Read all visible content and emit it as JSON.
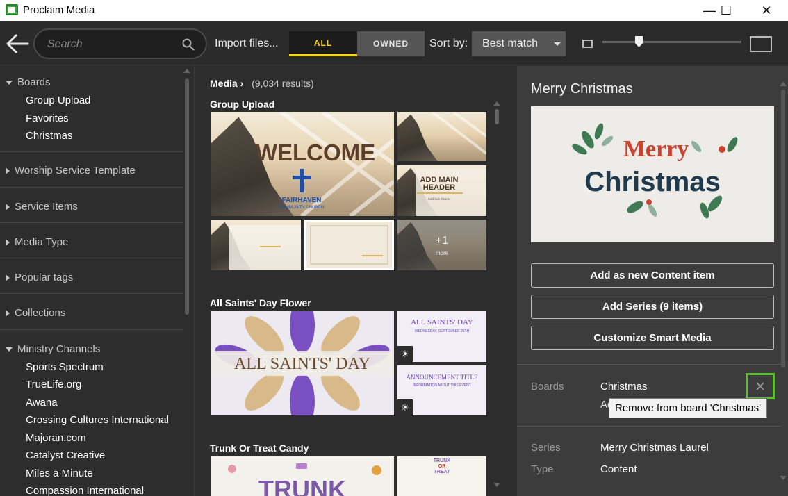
{
  "window": {
    "title": "Proclaim Media",
    "minimize_glyph": "—",
    "maximize_glyph": "☐",
    "close_glyph": "✕"
  },
  "toolbar": {
    "search_placeholder": "Search",
    "import_label": "Import files...",
    "filter_all": "ALL",
    "filter_owned": "OWNED",
    "sort_label": "Sort by:",
    "sort_value": "Best match",
    "thumb_size_fraction": 0.25
  },
  "sidebar": {
    "boards_header": "Boards",
    "boards_items": [
      "Group Upload",
      "Favorites",
      "Christmas"
    ],
    "sections": [
      "Worship Service Template",
      "Service Items",
      "Media Type",
      "Popular tags",
      "Collections"
    ],
    "channels_header": "Ministry Channels",
    "channels_items": [
      "Sports Spectrum",
      "TrueLife.org",
      "Awana",
      "Crossing Cultures International",
      "Majoran.com",
      "Catalyst Creative",
      "Miles a Minute",
      "Compassion International"
    ]
  },
  "media": {
    "crumb": "Media",
    "crumb_chevron": "›",
    "results": "(9,034 results)",
    "groups": {
      "group_upload": {
        "title": "Group Upload",
        "welcome_text": "WELCOME",
        "church_line1": "FAIRHAVEN",
        "church_line2": "COMMUNITY CHURCH",
        "header_line1": "ADD MAIN",
        "header_line2": "HEADER",
        "sub_header": "Add Sub Header",
        "more_count": "+1",
        "more_label": "more"
      },
      "all_saints": {
        "title": "All Saints' Day Flower",
        "main_text": "ALL SAINTS' DAY",
        "card1_title": "ALL SAINTS' DAY",
        "card1_sub": "WEDNESDAY, SEPTEMBER 25TH",
        "card2_title": "ANNOUNCEMENT TITLE",
        "card2_sub": "INFORMATION ABOUT THIS EVENT"
      },
      "trunk": {
        "title": "Trunk Or Treat Candy",
        "main_text": "TRUNK",
        "card1_line1": "TRUNK",
        "card1_line2": "OR",
        "card1_line3": "TREAT"
      }
    }
  },
  "detail": {
    "title": "Merry Christmas",
    "preview_line1": "Merry",
    "preview_line2": "Christmas",
    "btn_add_content": "Add as new Content item",
    "btn_add_series": "Add Series (9 items)",
    "btn_customize": "Customize Smart Media",
    "boards_label": "Boards",
    "boards_value": "Christmas",
    "boards_partial": "Ad",
    "remove_tooltip": "Remove from board 'Christmas'",
    "series_label": "Series",
    "series_value": "Merry Christmas Laurel",
    "type_label": "Type",
    "type_value": "Content"
  },
  "colors": {
    "accent_yellow": "#f4d31a",
    "highlight_green": "#5bbf2c",
    "christmas_red": "#c9432f",
    "christmas_navy": "#1f3a4d",
    "saints_purple": "#6a3fb0"
  }
}
